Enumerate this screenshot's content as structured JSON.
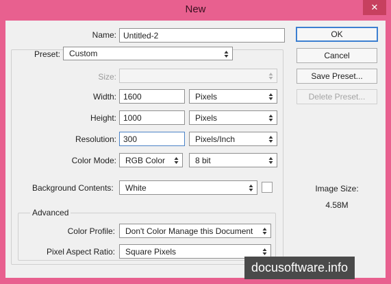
{
  "window": {
    "title": "New",
    "close_glyph": "✕"
  },
  "form": {
    "name_label": "Name:",
    "name_value": "Untitled-2",
    "preset_label": "Preset:",
    "preset_value": "Custom",
    "size_label": "Size:",
    "size_value": "",
    "width_label": "Width:",
    "width_value": "1600",
    "width_unit": "Pixels",
    "height_label": "Height:",
    "height_value": "1000",
    "height_unit": "Pixels",
    "resolution_label": "Resolution:",
    "resolution_value": "300",
    "resolution_unit": "Pixels/Inch",
    "color_mode_label": "Color Mode:",
    "color_mode_value": "RGB Color",
    "bit_depth_value": "8 bit",
    "background_label": "Background Contents:",
    "background_value": "White",
    "background_swatch_color": "#ffffff"
  },
  "advanced": {
    "legend": "Advanced",
    "color_profile_label": "Color Profile:",
    "color_profile_value": "Don't Color Manage this Document",
    "pixel_aspect_label": "Pixel Aspect Ratio:",
    "pixel_aspect_value": "Square Pixels"
  },
  "buttons": {
    "ok": "OK",
    "cancel": "Cancel",
    "save_preset": "Save Preset...",
    "delete_preset": "Delete Preset..."
  },
  "image_size": {
    "label": "Image Size:",
    "value": "4.58M"
  },
  "watermark": "docusoftware.info",
  "colors": {
    "frame": "#e8608f",
    "dialog": "#f0f0f0",
    "focus_border": "#4a82c6"
  }
}
